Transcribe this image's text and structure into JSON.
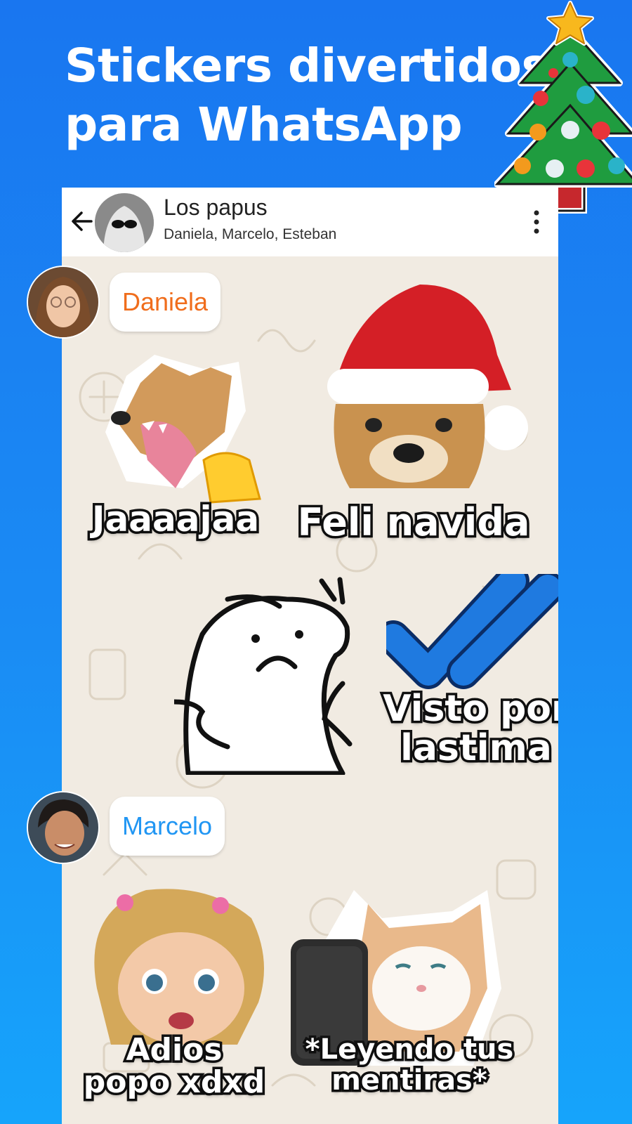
{
  "headline": {
    "line1": "Stickers divertidos",
    "line2": "para WhatsApp"
  },
  "chat": {
    "group_name": "Los papus",
    "members": "Daniela, Marcelo, Esteban",
    "back_icon": "arrow-left-icon",
    "menu_icon": "more-vertical-icon"
  },
  "senders": [
    {
      "name": "Daniela",
      "color": "#f06d1c"
    },
    {
      "name": "Marcelo",
      "color": "#2196f3"
    }
  ],
  "stickers": [
    {
      "caption": "Jaaaajaa"
    },
    {
      "caption": "Feli navida"
    },
    {
      "caption": ""
    },
    {
      "caption_line1": "Visto por",
      "caption_line2": "lastima"
    },
    {
      "caption_line1": "Adios",
      "caption_line2": "popo xdxd"
    },
    {
      "caption_line1": "*Leyendo tus",
      "caption_line2": "mentiras*"
    }
  ],
  "colors": {
    "background": "#1a8bf4",
    "chat_wallpaper": "#f1ebe2",
    "check_blue": "#1f7ae0"
  }
}
